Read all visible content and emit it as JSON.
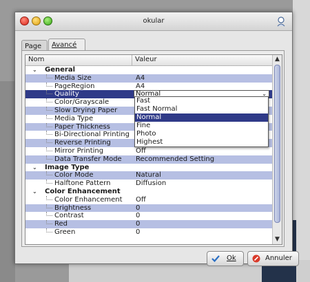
{
  "window": {
    "title": "okular"
  },
  "tabs": {
    "page": "Page",
    "advanced": "Avancé"
  },
  "table": {
    "headers": {
      "name": "Nom",
      "value": "Valeur"
    },
    "rows": [
      {
        "kind": "group",
        "name": "General",
        "value": ""
      },
      {
        "kind": "item",
        "name": "Media Size",
        "value": "A4",
        "alt": true
      },
      {
        "kind": "item",
        "name": "PageRegion",
        "value": "A4"
      },
      {
        "kind": "selected",
        "name": "Quality",
        "value": "Normal"
      },
      {
        "kind": "item",
        "name": "Color/Grayscale",
        "value": "",
        "alt": false
      },
      {
        "kind": "item",
        "name": "Slow Drying Paper",
        "value": "",
        "alt": true
      },
      {
        "kind": "item",
        "name": "Media Type",
        "value": ""
      },
      {
        "kind": "item",
        "name": "Paper Thickness",
        "value": "",
        "alt": true
      },
      {
        "kind": "item",
        "name": "Bi-Directional Printing",
        "value": ""
      },
      {
        "kind": "item",
        "name": "Reverse Printing",
        "value": "",
        "alt": true
      },
      {
        "kind": "item",
        "name": "Mirror Printing",
        "value": "Off"
      },
      {
        "kind": "item",
        "name": "Data Transfer Mode",
        "value": "Recommended Setting",
        "alt": true
      },
      {
        "kind": "group",
        "name": "Image Type",
        "value": ""
      },
      {
        "kind": "item",
        "name": "Color Mode",
        "value": "Natural",
        "alt": true
      },
      {
        "kind": "item",
        "name": "Halftone Pattern",
        "value": "Diffusion"
      },
      {
        "kind": "group",
        "name": "Color Enhancement",
        "value": "",
        "alt": true
      },
      {
        "kind": "item",
        "name": "Color Enhancement",
        "value": "Off"
      },
      {
        "kind": "item",
        "name": "Brightness",
        "value": "0",
        "alt": true
      },
      {
        "kind": "item",
        "name": "Contrast",
        "value": "0"
      },
      {
        "kind": "item",
        "name": "Red",
        "value": "0",
        "alt": true
      },
      {
        "kind": "item",
        "name": "Green",
        "value": "0"
      }
    ]
  },
  "quality_dropdown": {
    "options": [
      "Fast",
      "Fast Normal",
      "Normal",
      "Fine",
      "Photo",
      "Highest"
    ],
    "selected": "Normal"
  },
  "buttons": {
    "ok": "Ok",
    "cancel": "Annuler"
  },
  "icons": {
    "expand": "chevron-down-icon",
    "ok": "checkmark-icon",
    "cancel": "cancel-icon"
  },
  "colors": {
    "selection": "#2f3a88",
    "alt_row": "#b6bfe3"
  }
}
